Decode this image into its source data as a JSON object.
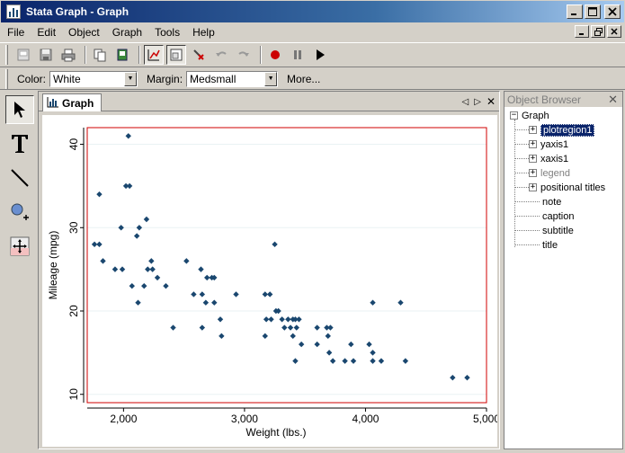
{
  "window": {
    "title": "Stata Graph - Graph",
    "min_icon": "minimize-icon",
    "restore_icon": "restore-icon",
    "max_icon": "maximize-icon",
    "close_icon": "close-icon"
  },
  "inner_window_buttons": [
    "minimize-icon",
    "restore-icon",
    "close-icon"
  ],
  "menu": [
    {
      "label": "File"
    },
    {
      "label": "Edit"
    },
    {
      "label": "Object"
    },
    {
      "label": "Graph"
    },
    {
      "label": "Tools"
    },
    {
      "label": "Help"
    }
  ],
  "propbar": {
    "color_label": "Color:",
    "color_value": "White",
    "margin_label": "Margin:",
    "margin_value": "Medsmall",
    "more_label": "More..."
  },
  "doc": {
    "tab_label": "Graph"
  },
  "object_browser": {
    "title": "Object Browser",
    "root": "Graph",
    "nodes": [
      {
        "label": "plotregion1",
        "expandable": true,
        "selected": true,
        "dim": false
      },
      {
        "label": "yaxis1",
        "expandable": true,
        "selected": false,
        "dim": false
      },
      {
        "label": "xaxis1",
        "expandable": true,
        "selected": false,
        "dim": false
      },
      {
        "label": "legend",
        "expandable": true,
        "selected": false,
        "dim": true
      },
      {
        "label": "positional titles",
        "expandable": true,
        "selected": false,
        "dim": false
      },
      {
        "label": "note",
        "expandable": false,
        "selected": false,
        "dim": false
      },
      {
        "label": "caption",
        "expandable": false,
        "selected": false,
        "dim": false
      },
      {
        "label": "subtitle",
        "expandable": false,
        "selected": false,
        "dim": false
      },
      {
        "label": "title",
        "expandable": false,
        "selected": false,
        "dim": false
      }
    ]
  },
  "chart_data": {
    "type": "scatter",
    "title": "",
    "xlabel": "Weight (lbs.)",
    "ylabel": "Mileage (mpg)",
    "xlim": [
      1700,
      5000
    ],
    "ylim": [
      9,
      42
    ],
    "xticks": [
      2000,
      3000,
      4000,
      5000
    ],
    "xtick_labels": [
      "2,000",
      "3,000",
      "4,000",
      "5,000"
    ],
    "yticks": [
      10,
      20,
      30,
      40
    ],
    "ytick_labels": [
      "10",
      "20",
      "30",
      "40"
    ],
    "grid": true,
    "marker_color": "#1a476f",
    "frame_color": "#d00000",
    "points": [
      [
        2040,
        41
      ],
      [
        1800,
        34
      ],
      [
        2020,
        35
      ],
      [
        2050,
        35
      ],
      [
        1760,
        28
      ],
      [
        1800,
        28
      ],
      [
        1830,
        26
      ],
      [
        1930,
        25
      ],
      [
        1990,
        25
      ],
      [
        1980,
        30
      ],
      [
        2130,
        30
      ],
      [
        2110,
        29
      ],
      [
        2190,
        31
      ],
      [
        2230,
        26
      ],
      [
        2200,
        25
      ],
      [
        2240,
        25
      ],
      [
        2280,
        24
      ],
      [
        2070,
        23
      ],
      [
        2170,
        23
      ],
      [
        2350,
        23
      ],
      [
        2520,
        26
      ],
      [
        2120,
        21
      ],
      [
        2410,
        18
      ],
      [
        2580,
        22
      ],
      [
        2640,
        25
      ],
      [
        2650,
        22
      ],
      [
        2690,
        24
      ],
      [
        2730,
        24
      ],
      [
        2750,
        24
      ],
      [
        2680,
        21
      ],
      [
        2650,
        18
      ],
      [
        2750,
        21
      ],
      [
        2800,
        19
      ],
      [
        2810,
        17
      ],
      [
        2930,
        22
      ],
      [
        3170,
        22
      ],
      [
        3210,
        22
      ],
      [
        3250,
        28
      ],
      [
        3180,
        19
      ],
      [
        3220,
        19
      ],
      [
        3260,
        20
      ],
      [
        3280,
        20
      ],
      [
        3310,
        19
      ],
      [
        3360,
        19
      ],
      [
        3170,
        17
      ],
      [
        3330,
        18
      ],
      [
        3380,
        18
      ],
      [
        3400,
        19
      ],
      [
        3420,
        19
      ],
      [
        3450,
        19
      ],
      [
        3400,
        17
      ],
      [
        3430,
        18
      ],
      [
        3470,
        16
      ],
      [
        3420,
        14
      ],
      [
        3600,
        18
      ],
      [
        3680,
        18
      ],
      [
        3710,
        18
      ],
      [
        3690,
        17
      ],
      [
        3600,
        16
      ],
      [
        3700,
        15
      ],
      [
        3730,
        14
      ],
      [
        3830,
        14
      ],
      [
        3880,
        16
      ],
      [
        3900,
        14
      ],
      [
        4030,
        16
      ],
      [
        4060,
        15
      ],
      [
        4060,
        21
      ],
      [
        4060,
        14
      ],
      [
        4130,
        14
      ],
      [
        4290,
        21
      ],
      [
        4330,
        14
      ],
      [
        4720,
        12
      ],
      [
        4840,
        12
      ]
    ]
  }
}
